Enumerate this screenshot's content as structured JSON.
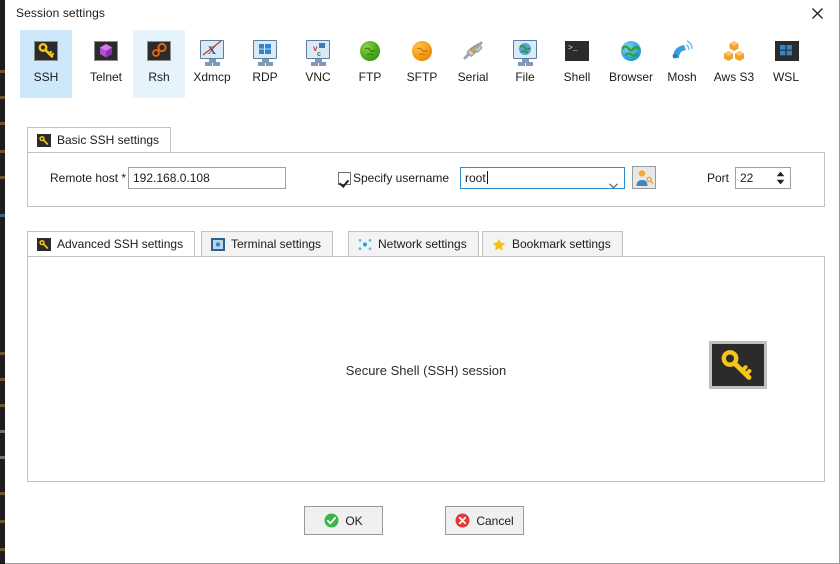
{
  "window": {
    "title": "Session settings",
    "close_icon": "close-icon"
  },
  "session_types": [
    {
      "label": "SSH",
      "icon": "ssh-key-icon",
      "state": "selected"
    },
    {
      "label": "Telnet",
      "icon": "telnet-cube-icon",
      "state": "normal"
    },
    {
      "label": "Rsh",
      "icon": "rsh-gears-icon",
      "state": "hover"
    },
    {
      "label": "Xdmcp",
      "icon": "xdmcp-monitor-icon",
      "state": "normal"
    },
    {
      "label": "RDP",
      "icon": "rdp-monitor-icon",
      "state": "normal"
    },
    {
      "label": "VNC",
      "icon": "vnc-monitor-icon",
      "state": "normal"
    },
    {
      "label": "FTP",
      "icon": "ftp-globe-icon",
      "state": "normal"
    },
    {
      "label": "SFTP",
      "icon": "sftp-globe-icon",
      "state": "normal"
    },
    {
      "label": "Serial",
      "icon": "serial-plug-icon",
      "state": "normal"
    },
    {
      "label": "File",
      "icon": "file-monitor-icon",
      "state": "normal"
    },
    {
      "label": "Shell",
      "icon": "shell-terminal-icon",
      "state": "normal"
    },
    {
      "label": "Browser",
      "icon": "browser-globe-icon",
      "state": "normal"
    },
    {
      "label": "Mosh",
      "icon": "mosh-satellite-icon",
      "state": "normal"
    },
    {
      "label": "Aws S3",
      "icon": "aws-s3-cubes-icon",
      "state": "normal"
    },
    {
      "label": "WSL",
      "icon": "wsl-windows-icon",
      "state": "normal"
    }
  ],
  "basic_tab": {
    "label": "Basic SSH settings",
    "icon": "ssh-key-icon",
    "remote_host": {
      "label": "Remote host *",
      "value": "192.168.0.108",
      "placeholder": ""
    },
    "specify_username": {
      "label": "Specify username",
      "checked": true
    },
    "username": {
      "value": "root",
      "placeholder": "",
      "dropdown_icon": "chevron-down-icon"
    },
    "user_picker_button": {
      "icon": "user-key-icon",
      "tooltip": ""
    },
    "port": {
      "label": "Port",
      "value": "22",
      "spinner_icon": "spinner-arrows-icon"
    }
  },
  "sub_tabs": [
    {
      "label": "Advanced SSH settings",
      "icon": "ssh-key-icon",
      "active": true
    },
    {
      "label": "Terminal settings",
      "icon": "terminal-icon",
      "active": false
    },
    {
      "label": "Network settings",
      "icon": "network-nodes-icon",
      "active": false
    },
    {
      "label": "Bookmark settings",
      "icon": "star-icon",
      "active": false
    }
  ],
  "session_panel": {
    "description": "Secure Shell (SSH) session",
    "emblem_icon": "ssh-key-large-icon"
  },
  "buttons": {
    "ok": {
      "label": "OK",
      "icon": "check-circle-icon"
    },
    "cancel": {
      "label": "Cancel",
      "icon": "x-circle-icon"
    }
  },
  "colors": {
    "selected_tile": "#cde8fa",
    "hover_tile": "#e5f3fc",
    "focus_border": "#2a8fd4",
    "key_gold": "#f5c518",
    "ok_green": "#3cb44a",
    "cancel_red": "#e03b3b",
    "aws_orange": "#f59a12",
    "dialog_bg": "#ffffff"
  }
}
